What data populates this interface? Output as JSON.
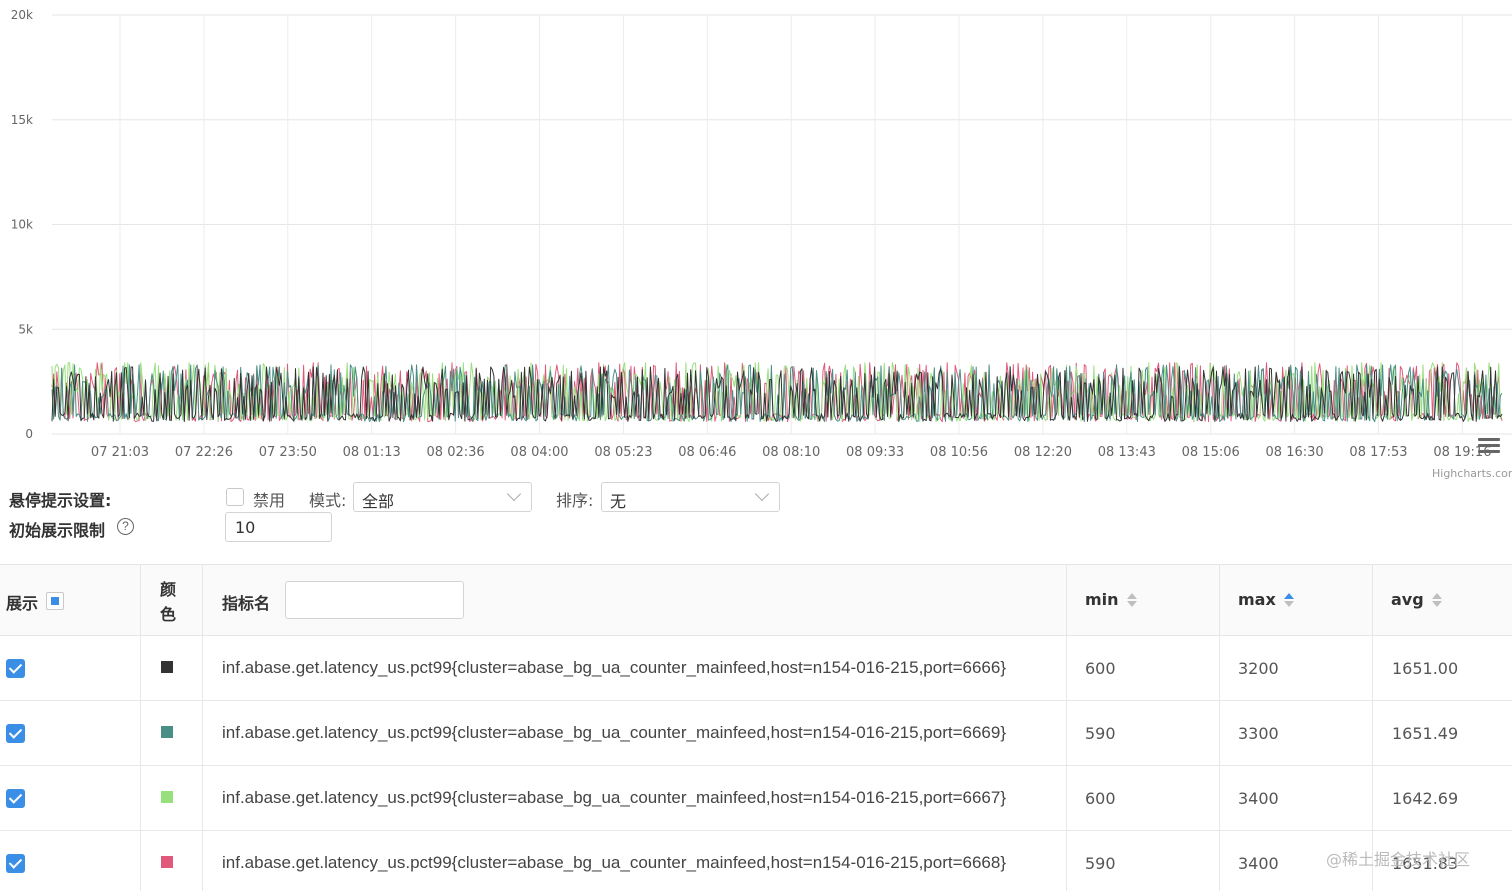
{
  "chart_data": {
    "type": "line",
    "y_ticks": [
      "0",
      "5k",
      "10k",
      "15k",
      "20k"
    ],
    "ylim": [
      0,
      20000
    ],
    "x_ticks": [
      "07 21:03",
      "07 22:26",
      "07 23:50",
      "08 01:13",
      "08 02:36",
      "08 04:00",
      "08 05:23",
      "08 06:46",
      "08 08:10",
      "08 09:33",
      "08 10:56",
      "08 12:20",
      "08 13:43",
      "08 15:06",
      "08 16:30",
      "08 17:53",
      "08 19:16"
    ],
    "credit": "Highcharts.com",
    "grid": true,
    "legend": "none",
    "series": [
      {
        "color": "#333333",
        "min": 600,
        "max": 3200,
        "avg": 1651.0
      },
      {
        "color": "#4a8f86",
        "min": 590,
        "max": 3300,
        "avg": 1651.49
      },
      {
        "color": "#98e07d",
        "min": 600,
        "max": 3400,
        "avg": 1642.69
      },
      {
        "color": "#e0597a",
        "min": 590,
        "max": 3400,
        "avg": 1651.83
      }
    ]
  },
  "settings": {
    "hover_label": "悬停提示设置:",
    "disable_label": "禁用",
    "mode_label": "模式:",
    "mode_value": "全部",
    "sort_label": "排序:",
    "sort_value": "无",
    "limit_label": "初始展示限制",
    "limit_value": "10"
  },
  "table": {
    "headers": {
      "show": "展示",
      "color": "颜色",
      "name": "指标名",
      "min": "min",
      "max": "max",
      "avg": "avg"
    },
    "rows": [
      {
        "color": "#333333",
        "name": "inf.abase.get.latency_us.pct99{cluster=abase_bg_ua_counter_mainfeed,host=n154-016-215,port=6666}",
        "min": "600",
        "max": "3200",
        "avg": "1651.00"
      },
      {
        "color": "#4a8f86",
        "name": "inf.abase.get.latency_us.pct99{cluster=abase_bg_ua_counter_mainfeed,host=n154-016-215,port=6669}",
        "min": "590",
        "max": "3300",
        "avg": "1651.49"
      },
      {
        "color": "#98e07d",
        "name": "inf.abase.get.latency_us.pct99{cluster=abase_bg_ua_counter_mainfeed,host=n154-016-215,port=6667}",
        "min": "600",
        "max": "3400",
        "avg": "1642.69"
      },
      {
        "color": "#e0597a",
        "name": "inf.abase.get.latency_us.pct99{cluster=abase_bg_ua_counter_mainfeed,host=n154-016-215,port=6668}",
        "min": "590",
        "max": "3400",
        "avg": "1651.83"
      }
    ]
  },
  "watermark": "@稀土掘金技术社区"
}
